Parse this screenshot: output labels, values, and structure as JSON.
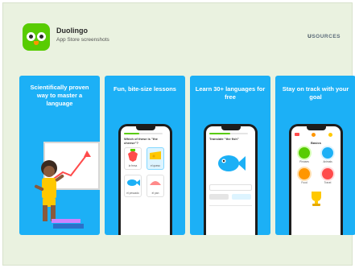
{
  "header": {
    "app_name": "Duolingo",
    "subtitle": "App Store screenshots",
    "brand_prefix": "U",
    "brand_rest": "SOURCES"
  },
  "colors": {
    "background": "#eaf2e0",
    "card_blue": "#1cb0f6",
    "duo_green": "#58cc02"
  },
  "cards": [
    {
      "caption": "Scientifically proven way to master a language"
    },
    {
      "caption": "Fun, bite-size lessons",
      "screen": {
        "prompt": "Which of these is \"the cheese\"?",
        "options": [
          "la fresa",
          "el queso",
          "el pescado",
          "el pan"
        ]
      }
    },
    {
      "caption": "Learn 30+ languages for free",
      "screen": {
        "prompt": "Translate \"the fish\""
      }
    },
    {
      "caption": "Stay on track with your goal",
      "screen": {
        "header": "Basics",
        "lessons": [
          "Phrases",
          "Animals",
          "Food",
          "Travel"
        ]
      }
    }
  ]
}
